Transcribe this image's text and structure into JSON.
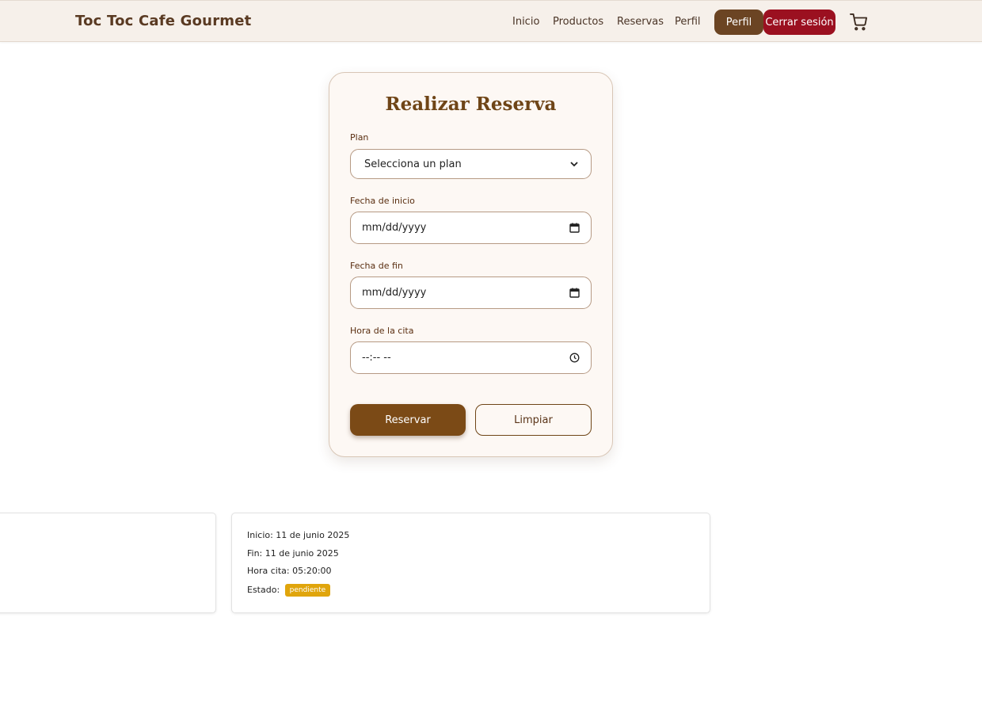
{
  "navbar": {
    "brand": "Toc Toc Cafe Gourmet",
    "links": [
      "Inicio",
      "Productos",
      "Reservas",
      "Perfil"
    ],
    "perfil_button": "Perfil",
    "logout_button": "Cerrar sesión",
    "cart_icon": "cart-icon"
  },
  "form": {
    "title": "Realizar Reserva",
    "plan_label": "Plan",
    "plan_value": "Selecciona un plan",
    "start_label": "Fecha de inicio",
    "start_value": "mm/dd/yyyy",
    "end_label": "Fecha de fin",
    "end_value": "mm/dd/yyyy",
    "time_label": "Hora de la cita",
    "time_value": "--:-- --",
    "submit_button": "Reservar",
    "clear_button": "Limpiar"
  },
  "reservations": [
    {
      "inicio": "Inicio: 11 de junio 2025",
      "fin": "Fin: 11 de junio 2025",
      "hora": "Hora cita: 05:20:00",
      "estado_label": "Estado:",
      "estado": "pendiente"
    }
  ],
  "colors": {
    "brand_brown": "#6b4423",
    "logout_red": "#9b1020",
    "badge_pending": "#e0a50c"
  }
}
